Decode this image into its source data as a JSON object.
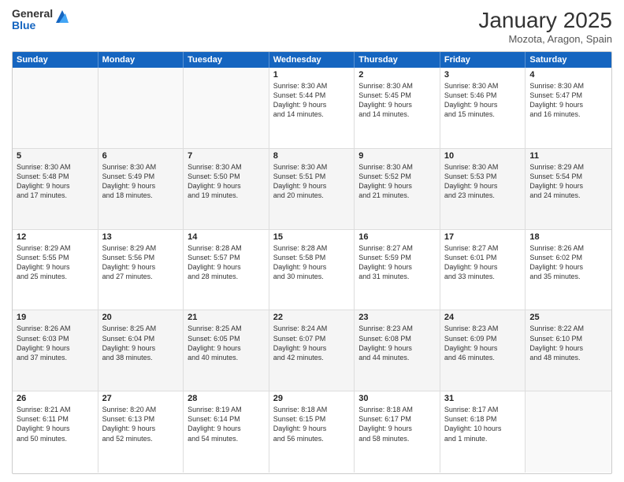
{
  "logo": {
    "general": "General",
    "blue": "Blue"
  },
  "header": {
    "month": "January 2025",
    "location": "Mozota, Aragon, Spain"
  },
  "weekdays": [
    "Sunday",
    "Monday",
    "Tuesday",
    "Wednesday",
    "Thursday",
    "Friday",
    "Saturday"
  ],
  "rows": [
    [
      {
        "day": "",
        "text": ""
      },
      {
        "day": "",
        "text": ""
      },
      {
        "day": "",
        "text": ""
      },
      {
        "day": "1",
        "text": "Sunrise: 8:30 AM\nSunset: 5:44 PM\nDaylight: 9 hours\nand 14 minutes."
      },
      {
        "day": "2",
        "text": "Sunrise: 8:30 AM\nSunset: 5:45 PM\nDaylight: 9 hours\nand 14 minutes."
      },
      {
        "day": "3",
        "text": "Sunrise: 8:30 AM\nSunset: 5:46 PM\nDaylight: 9 hours\nand 15 minutes."
      },
      {
        "day": "4",
        "text": "Sunrise: 8:30 AM\nSunset: 5:47 PM\nDaylight: 9 hours\nand 16 minutes."
      }
    ],
    [
      {
        "day": "5",
        "text": "Sunrise: 8:30 AM\nSunset: 5:48 PM\nDaylight: 9 hours\nand 17 minutes."
      },
      {
        "day": "6",
        "text": "Sunrise: 8:30 AM\nSunset: 5:49 PM\nDaylight: 9 hours\nand 18 minutes."
      },
      {
        "day": "7",
        "text": "Sunrise: 8:30 AM\nSunset: 5:50 PM\nDaylight: 9 hours\nand 19 minutes."
      },
      {
        "day": "8",
        "text": "Sunrise: 8:30 AM\nSunset: 5:51 PM\nDaylight: 9 hours\nand 20 minutes."
      },
      {
        "day": "9",
        "text": "Sunrise: 8:30 AM\nSunset: 5:52 PM\nDaylight: 9 hours\nand 21 minutes."
      },
      {
        "day": "10",
        "text": "Sunrise: 8:30 AM\nSunset: 5:53 PM\nDaylight: 9 hours\nand 23 minutes."
      },
      {
        "day": "11",
        "text": "Sunrise: 8:29 AM\nSunset: 5:54 PM\nDaylight: 9 hours\nand 24 minutes."
      }
    ],
    [
      {
        "day": "12",
        "text": "Sunrise: 8:29 AM\nSunset: 5:55 PM\nDaylight: 9 hours\nand 25 minutes."
      },
      {
        "day": "13",
        "text": "Sunrise: 8:29 AM\nSunset: 5:56 PM\nDaylight: 9 hours\nand 27 minutes."
      },
      {
        "day": "14",
        "text": "Sunrise: 8:28 AM\nSunset: 5:57 PM\nDaylight: 9 hours\nand 28 minutes."
      },
      {
        "day": "15",
        "text": "Sunrise: 8:28 AM\nSunset: 5:58 PM\nDaylight: 9 hours\nand 30 minutes."
      },
      {
        "day": "16",
        "text": "Sunrise: 8:27 AM\nSunset: 5:59 PM\nDaylight: 9 hours\nand 31 minutes."
      },
      {
        "day": "17",
        "text": "Sunrise: 8:27 AM\nSunset: 6:01 PM\nDaylight: 9 hours\nand 33 minutes."
      },
      {
        "day": "18",
        "text": "Sunrise: 8:26 AM\nSunset: 6:02 PM\nDaylight: 9 hours\nand 35 minutes."
      }
    ],
    [
      {
        "day": "19",
        "text": "Sunrise: 8:26 AM\nSunset: 6:03 PM\nDaylight: 9 hours\nand 37 minutes."
      },
      {
        "day": "20",
        "text": "Sunrise: 8:25 AM\nSunset: 6:04 PM\nDaylight: 9 hours\nand 38 minutes."
      },
      {
        "day": "21",
        "text": "Sunrise: 8:25 AM\nSunset: 6:05 PM\nDaylight: 9 hours\nand 40 minutes."
      },
      {
        "day": "22",
        "text": "Sunrise: 8:24 AM\nSunset: 6:07 PM\nDaylight: 9 hours\nand 42 minutes."
      },
      {
        "day": "23",
        "text": "Sunrise: 8:23 AM\nSunset: 6:08 PM\nDaylight: 9 hours\nand 44 minutes."
      },
      {
        "day": "24",
        "text": "Sunrise: 8:23 AM\nSunset: 6:09 PM\nDaylight: 9 hours\nand 46 minutes."
      },
      {
        "day": "25",
        "text": "Sunrise: 8:22 AM\nSunset: 6:10 PM\nDaylight: 9 hours\nand 48 minutes."
      }
    ],
    [
      {
        "day": "26",
        "text": "Sunrise: 8:21 AM\nSunset: 6:11 PM\nDaylight: 9 hours\nand 50 minutes."
      },
      {
        "day": "27",
        "text": "Sunrise: 8:20 AM\nSunset: 6:13 PM\nDaylight: 9 hours\nand 52 minutes."
      },
      {
        "day": "28",
        "text": "Sunrise: 8:19 AM\nSunset: 6:14 PM\nDaylight: 9 hours\nand 54 minutes."
      },
      {
        "day": "29",
        "text": "Sunrise: 8:18 AM\nSunset: 6:15 PM\nDaylight: 9 hours\nand 56 minutes."
      },
      {
        "day": "30",
        "text": "Sunrise: 8:18 AM\nSunset: 6:17 PM\nDaylight: 9 hours\nand 58 minutes."
      },
      {
        "day": "31",
        "text": "Sunrise: 8:17 AM\nSunset: 6:18 PM\nDaylight: 10 hours\nand 1 minute."
      },
      {
        "day": "",
        "text": ""
      }
    ]
  ]
}
